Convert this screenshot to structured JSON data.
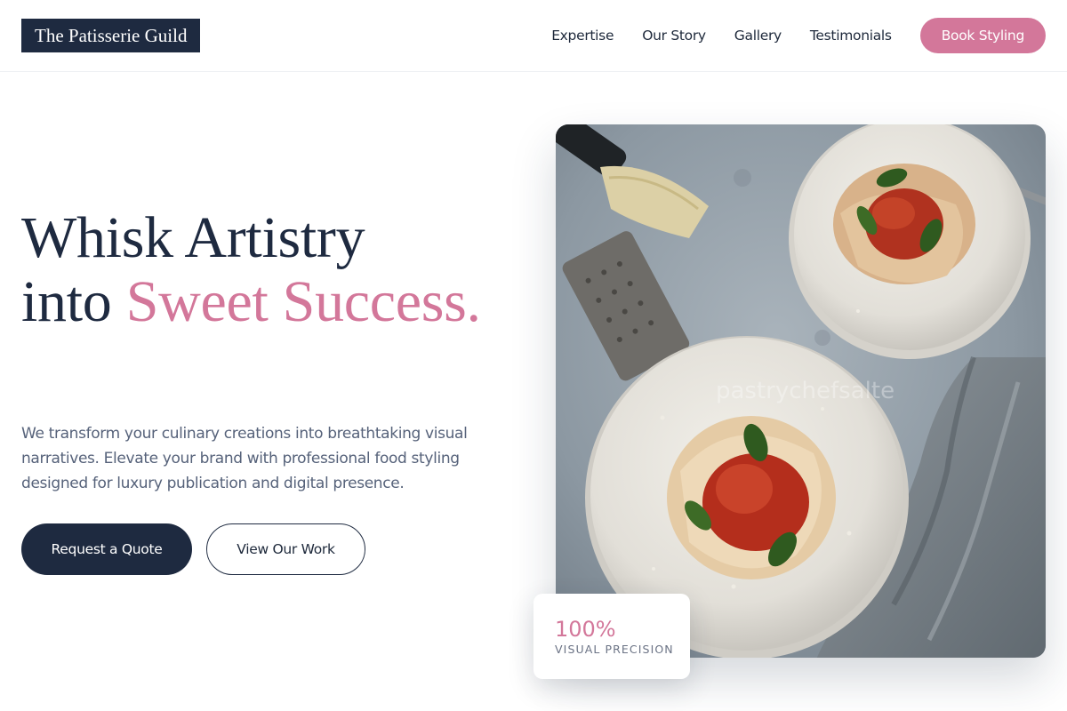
{
  "header": {
    "logo": "The Patisserie Guild",
    "nav": [
      "Expertise",
      "Our Story",
      "Gallery",
      "Testimonials"
    ],
    "cta": "Book Styling"
  },
  "hero": {
    "headline_part1": "Whisk Artistry",
    "headline_part2": "into ",
    "headline_accent": "Sweet Success.",
    "description": "We transform your culinary creations into breathtaking visual narratives. Elevate your brand with professional food styling designed for luxury publication and digital presence.",
    "primary_button": "Request a Quote",
    "secondary_button": "View Our Work",
    "image_watermark": "pastrychefsalte"
  },
  "stat": {
    "value": "100%",
    "label": "VISUAL PRECISION"
  },
  "colors": {
    "navy": "#1e2a40",
    "accent": "#d3779a",
    "muted_text": "#56627a"
  }
}
